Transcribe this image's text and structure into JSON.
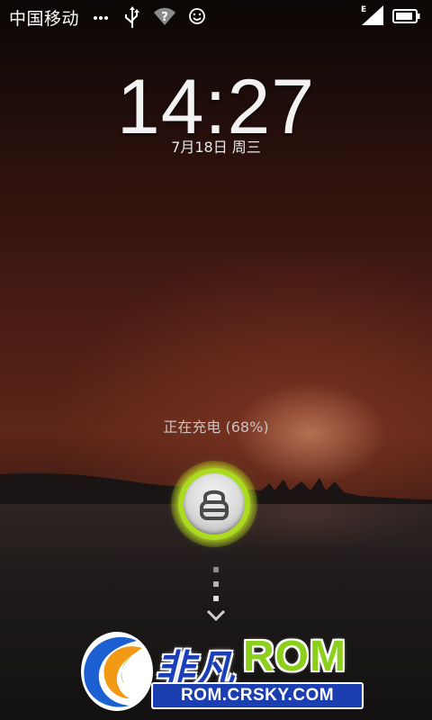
{
  "status_bar": {
    "carrier": "中国移动",
    "icons": [
      "more-dots-icon",
      "usb-icon",
      "wifi-unknown-icon",
      "smiley-icon",
      "signal-edge-icon",
      "battery-icon"
    ],
    "network_type": "E"
  },
  "lockscreen": {
    "time": "14:27",
    "date": "7月18日 周三",
    "charging_status": "正在充电 (68%)",
    "battery_percent": 68,
    "unlock_icon": "lock-icon",
    "swipe_hint_icon": "chevron-down-icon"
  },
  "watermark": {
    "brand": "非凡",
    "rom": "ROM",
    "url": "ROM.CRSKY.COM"
  },
  "colors": {
    "unlock_ring": "#b8e626",
    "watermark_blue": "#1b3fb0",
    "watermark_green": "#8ccf1c"
  }
}
